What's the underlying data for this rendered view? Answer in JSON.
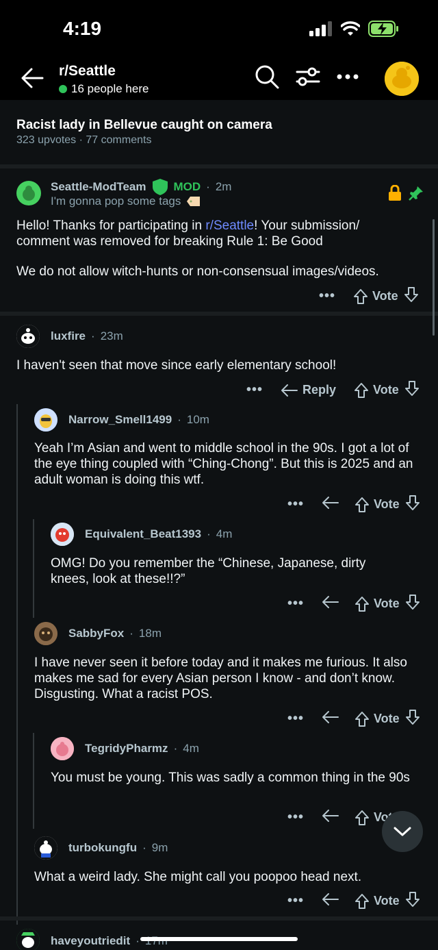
{
  "status": {
    "time": "4:19"
  },
  "nav": {
    "subreddit": "r/Seattle",
    "online": "16 people here"
  },
  "post": {
    "title": "Racist lady in Bellevue caught on camera",
    "meta": "323 upvotes · 77 comments"
  },
  "mod_comment": {
    "user": "Seattle-ModTeam",
    "badge": "MOD",
    "time": "2m",
    "flair": "I'm gonna pop some tags",
    "body_pre": "Hello! Thanks for participating in ",
    "link": "r/Seattle",
    "body_post": "! Your submission/ comment was removed for breaking Rule 1: Be Good",
    "body2": "We do not allow witch-hunts or non-consensual images/videos.",
    "vote": "Vote"
  },
  "comments": [
    {
      "user": "luxfire",
      "time": "23m",
      "body": "I haven't seen that move since early elementary school!",
      "reply": "Reply",
      "vote": "Vote"
    },
    {
      "user": "Narrow_Smell1499",
      "time": "10m",
      "body": "Yeah I’m Asian and went to middle school in the 90s. I got a lot of the eye thing coupled with “Ching-Chong”.  But this is 2025 and an adult woman is doing this wtf.",
      "vote": "Vote"
    },
    {
      "user": "Equivalent_Beat1393",
      "time": "4m",
      "body": "OMG! Do you remember the “Chinese, Japanese, dirty knees, look at these!!?”",
      "vote": "Vote"
    },
    {
      "user": "SabbyFox",
      "time": "18m",
      "body": "I have never seen it before today and it makes me furious. It also makes me sad for every Asian person I know - and don’t know. Disgusting. What a racist POS.",
      "vote": "Vote"
    },
    {
      "user": "TegridyPharmz",
      "time": "4m",
      "body": "You must be young. This was sadly a common thing in the 90s",
      "vote": "Vote"
    },
    {
      "user": "turbokungfu",
      "time": "9m",
      "body": "What a weird lady. She might call you poopoo head next.",
      "vote": "Vote"
    },
    {
      "user": "haveyoutriedit",
      "time": "17m"
    }
  ],
  "colors": {
    "accent": "#6f8bff",
    "mod_green": "#2fc35a",
    "background": "#0e1113"
  }
}
